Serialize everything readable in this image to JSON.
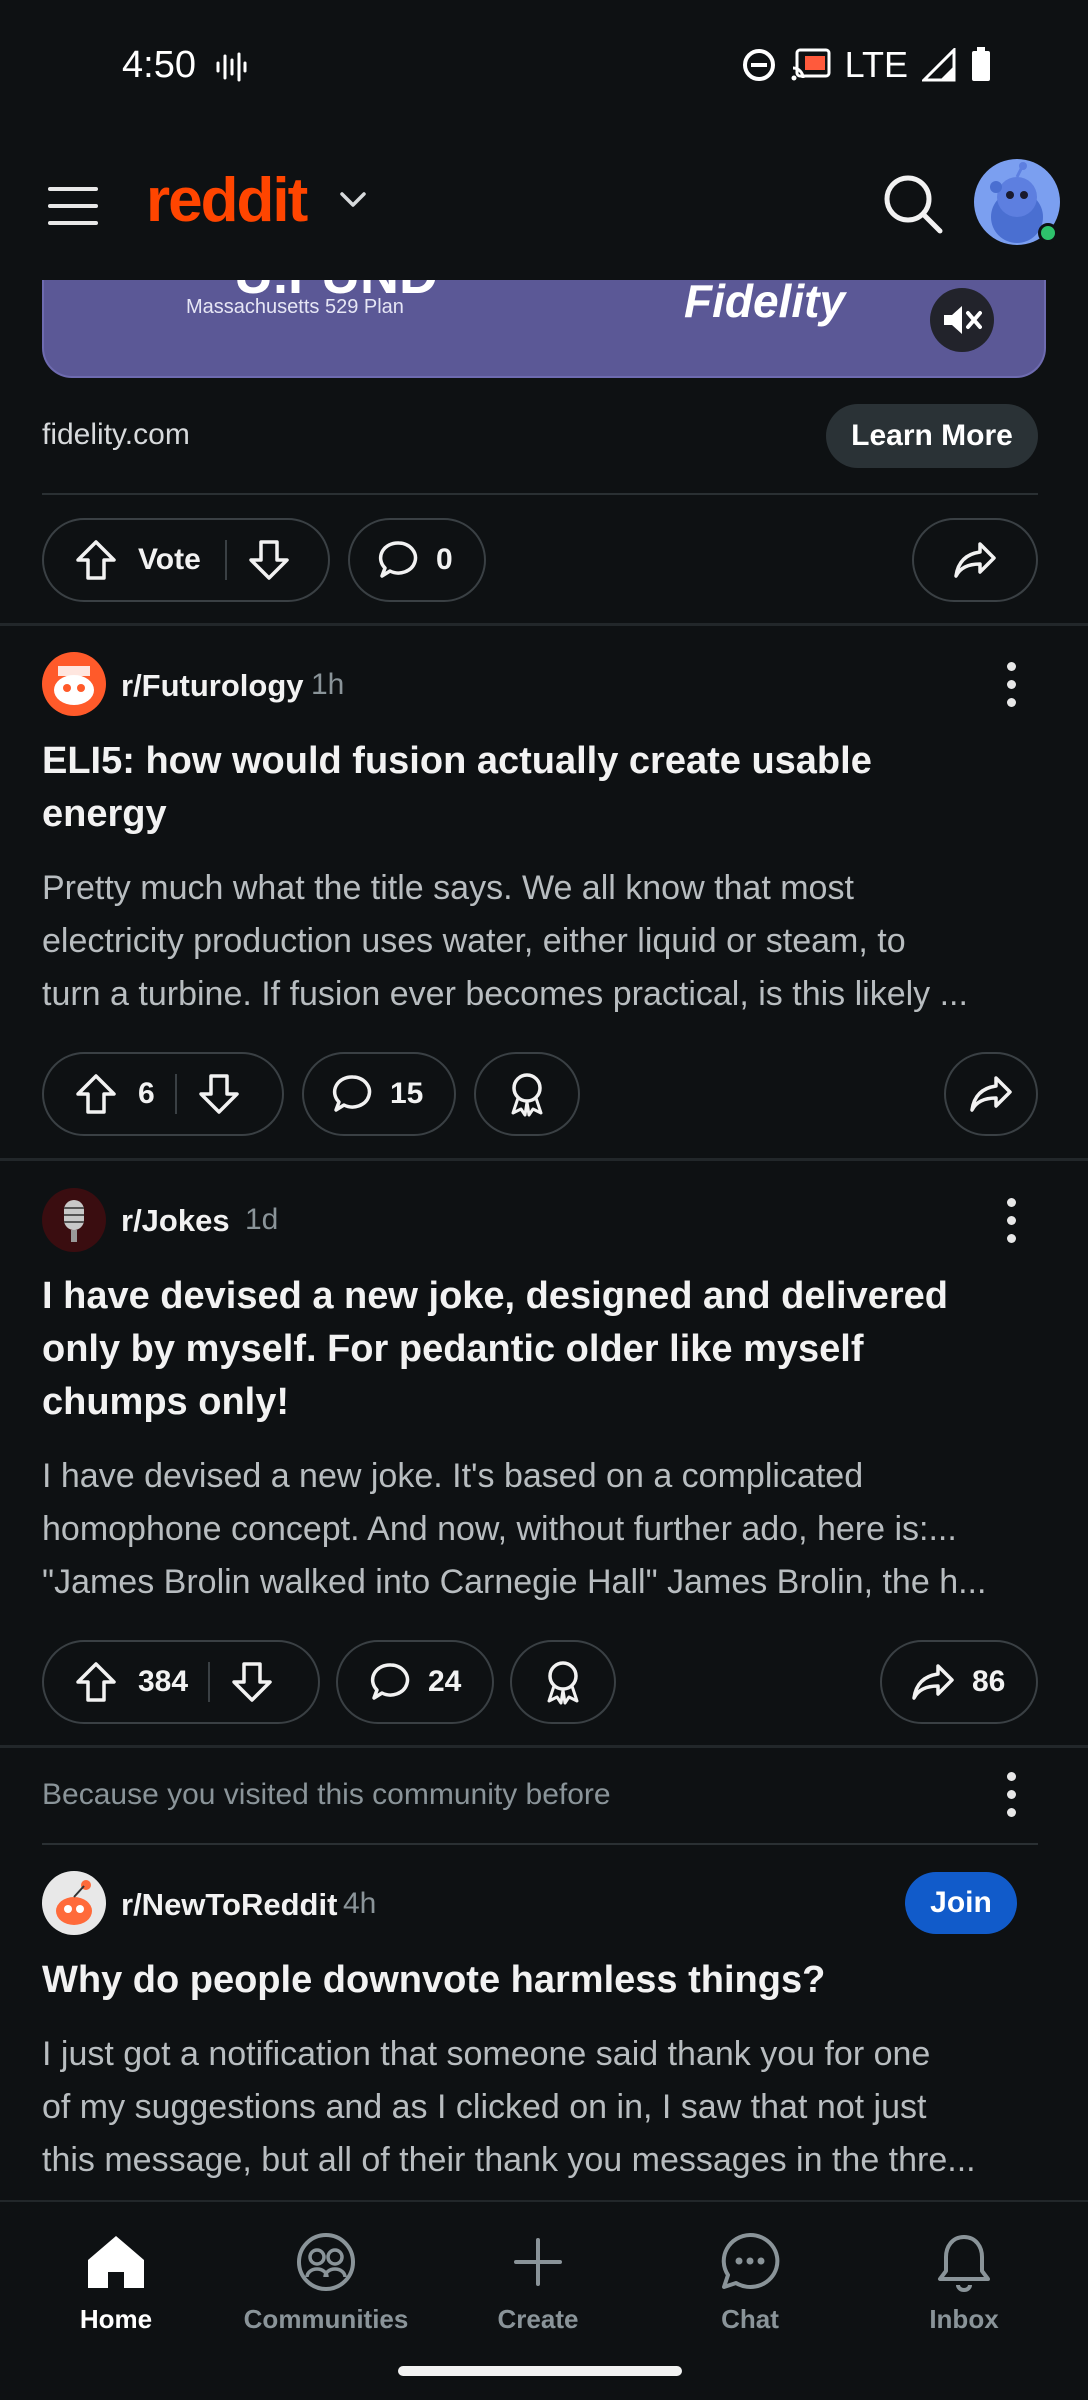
{
  "status_bar": {
    "time": "4:50",
    "network": "LTE"
  },
  "header": {
    "logo": "reddit"
  },
  "ad": {
    "banner_sub": "Massachusetts 529 Plan",
    "banner_brand": "Fidelity",
    "banner_headline_partial": "U.FUND",
    "domain": "fidelity.com",
    "cta": "Learn More",
    "vote_label": "Vote",
    "comments": "0"
  },
  "posts": [
    {
      "subreddit": "r/Futurology",
      "age": "1h",
      "title_lines": [
        "ELI5: how would fusion actually create usable",
        "energy"
      ],
      "body_lines": [
        "Pretty much what the title says. We all know that most",
        "electricity production uses water, either liquid or steam, to",
        "turn a turbine. If fusion ever becomes practical, is this likely ..."
      ],
      "votes": "6",
      "comments": "15"
    },
    {
      "subreddit": "r/Jokes",
      "age": "1d",
      "title_lines": [
        "I have devised a new joke, designed and delivered",
        "only by myself. For pedantic older like myself",
        "chumps only!"
      ],
      "body_lines": [
        "I have devised a new joke. It's based on a complicated",
        "homophone concept. And now, without further ado, here is:...",
        "\"James Brolin walked into Carnegie Hall\" James Brolin, the h..."
      ],
      "votes": "384",
      "comments": "24",
      "shares": "86"
    },
    {
      "recommendation": "Because you visited this community before",
      "subreddit": "r/NewToReddit",
      "age": "4h",
      "join_label": "Join",
      "title_lines": [
        "Why do people downvote harmless things?"
      ],
      "body_lines": [
        "I just got a notification that someone said thank you for one",
        "of my suggestions and as I clicked on in, I saw that not just",
        "this message, but all of their thank you messages in the thre..."
      ]
    }
  ],
  "bottom_nav": [
    {
      "label": "Home",
      "icon": "home-icon",
      "active": true
    },
    {
      "label": "Communities",
      "icon": "communities-icon",
      "active": false
    },
    {
      "label": "Create",
      "icon": "plus-icon",
      "active": false
    },
    {
      "label": "Chat",
      "icon": "chat-icon",
      "active": false
    },
    {
      "label": "Inbox",
      "icon": "bell-icon",
      "active": false
    }
  ],
  "colors": {
    "brand": "#ff4500",
    "join": "#115bca",
    "background": "#0e1113",
    "online": "#2ec26b"
  }
}
